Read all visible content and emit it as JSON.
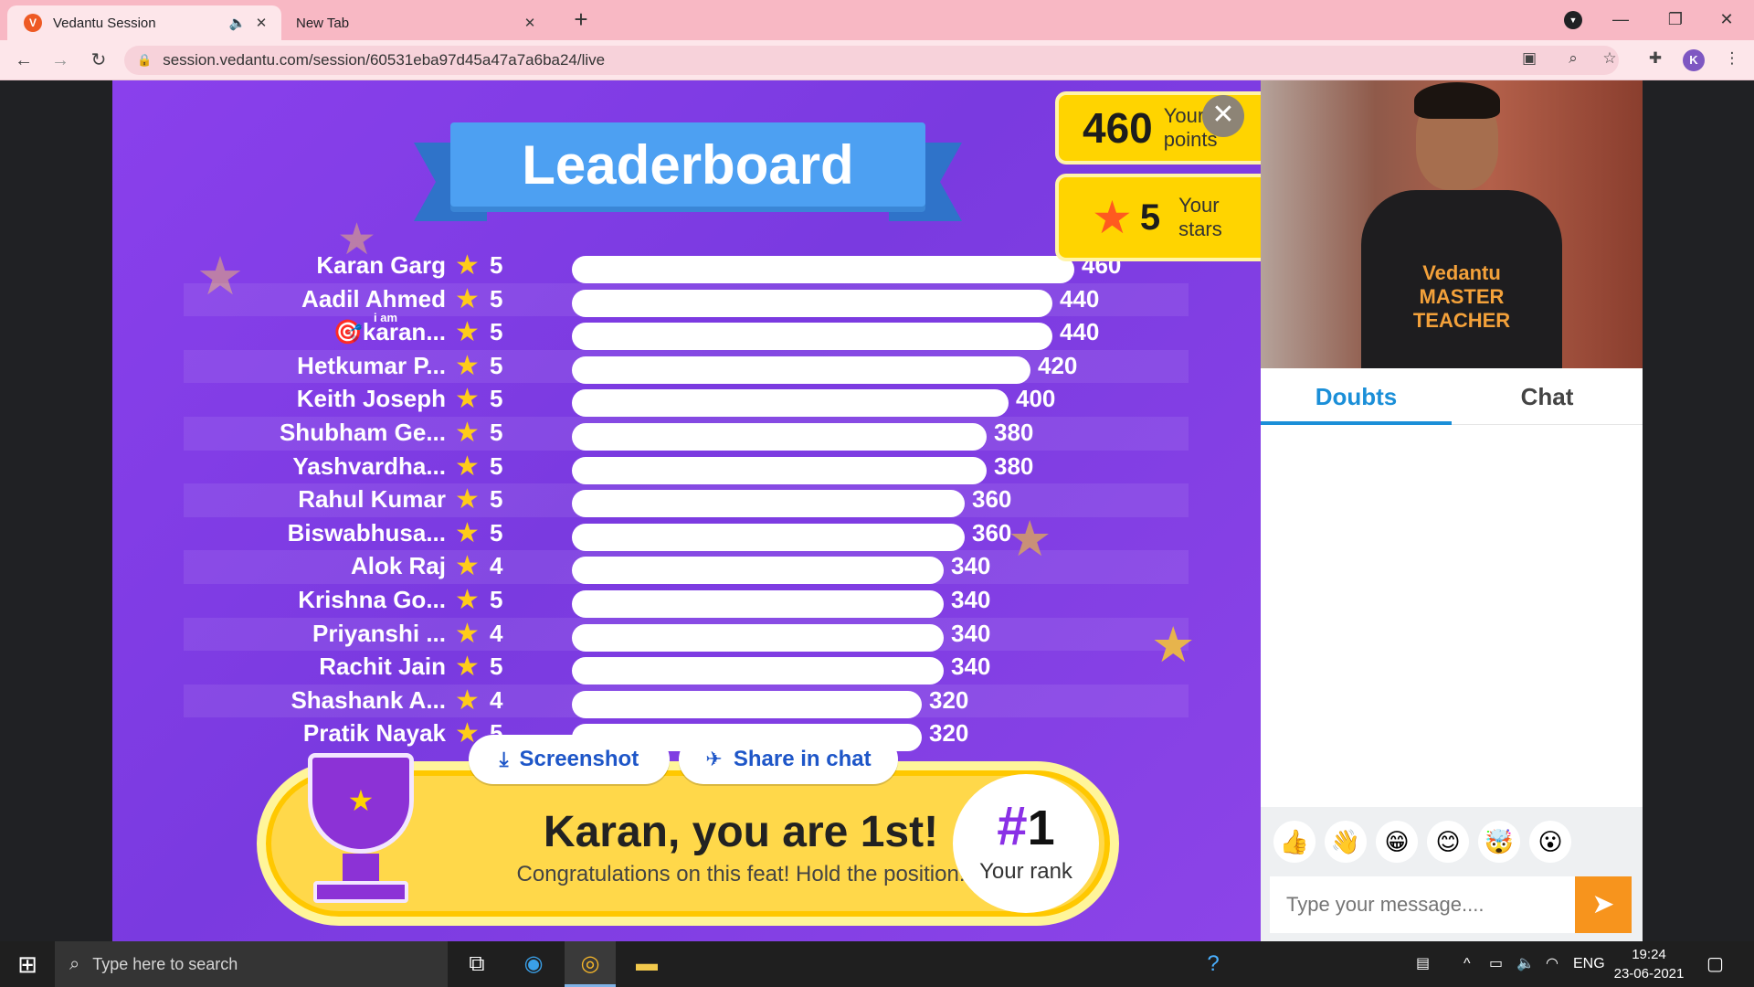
{
  "browser": {
    "tabs": [
      {
        "title": "Vedantu Session",
        "favicon_letter": "V",
        "active": true
      },
      {
        "title": "New Tab",
        "active": false
      }
    ],
    "url": "session.vedantu.com/session/60531eba97d45a47a7a6ba24/live",
    "profile_initial": "K"
  },
  "leaderboard": {
    "title": "Leaderboard",
    "rows": [
      {
        "name": "Karan Garg",
        "stars": "5",
        "points": 460
      },
      {
        "name": "Aadil Ahmed",
        "stars": "5",
        "points": 440
      },
      {
        "name": "🎯karan...",
        "stars": "5",
        "points": 440
      },
      {
        "name": "Hetkumar P...",
        "stars": "5",
        "points": 420
      },
      {
        "name": "Keith Joseph",
        "stars": "5",
        "points": 400
      },
      {
        "name": "Shubham Ge...",
        "stars": "5",
        "points": 380
      },
      {
        "name": "Yashvardha...",
        "stars": "5",
        "points": 380
      },
      {
        "name": "Rahul Kumar",
        "stars": "5",
        "points": 360
      },
      {
        "name": "Biswabhusa...",
        "stars": "5",
        "points": 360
      },
      {
        "name": "Alok Raj",
        "stars": "4",
        "points": 340
      },
      {
        "name": "Krishna Go...",
        "stars": "5",
        "points": 340
      },
      {
        "name": "Priyanshi ...",
        "stars": "4",
        "points": 340
      },
      {
        "name": "Rachit Jain",
        "stars": "5",
        "points": 340
      },
      {
        "name": "Shashank A...",
        "stars": "4",
        "points": 320
      },
      {
        "name": "Pratik Nayak",
        "stars": "5",
        "points": 320
      }
    ],
    "row3_overlay": "i am"
  },
  "score": {
    "points_value": "460",
    "points_label": "Your points",
    "stars_value": "5",
    "stars_label": "Your stars"
  },
  "banner": {
    "title": "Karan, you are 1st!",
    "subtitle": "Congratulations on this feat! Hold the position!",
    "rank_hash": "#",
    "rank_number": "1",
    "rank_label": "Your rank"
  },
  "actions": {
    "screenshot_label": "Screenshot",
    "share_label": "Share in chat"
  },
  "video": {
    "shirt_text": "Vedantu MASTER TEACHER"
  },
  "side_panel": {
    "tabs": [
      "Doubts",
      "Chat"
    ],
    "active_tab": "Doubts",
    "emojis": [
      "👍",
      "👋",
      "😁",
      "😊",
      "🤯",
      "😮"
    ],
    "message_placeholder": "Type your message...."
  },
  "taskbar": {
    "search_placeholder": "Type here to search",
    "language": "ENG",
    "time": "19:24",
    "date": "23-06-2021"
  },
  "colors": {
    "stage_purple": "#8a40ec",
    "ribbon_blue": "#4da0f2",
    "banner_yellow": "#ffd84a",
    "doubts_blue": "#1b8fd8",
    "send_orange": "#f7941d",
    "tab_pink": "#f8b8c4"
  }
}
